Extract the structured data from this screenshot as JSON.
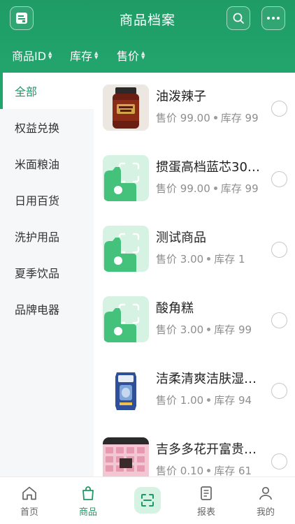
{
  "header": {
    "title": "商品档案",
    "logo_icon": "store-logo-icon",
    "search_icon": "search-icon",
    "more_icon": "more-dots-icon"
  },
  "sort_bar": {
    "items": [
      {
        "label": "商品ID"
      },
      {
        "label": "库存"
      },
      {
        "label": "售价"
      }
    ]
  },
  "sidebar": {
    "categories": [
      {
        "label": "全部",
        "active": true
      },
      {
        "label": "权益兑换"
      },
      {
        "label": "米面粮油"
      },
      {
        "label": "日用百货"
      },
      {
        "label": "洗护用品"
      },
      {
        "label": "夏季饮品"
      },
      {
        "label": "品牌电器"
      }
    ]
  },
  "products": {
    "price_prefix": "售价",
    "stock_prefix": "库存",
    "items": [
      {
        "name": "油泼辣子",
        "price": "99.00",
        "stock": "99",
        "image": "jar-photo"
      },
      {
        "name": "掼蛋高档蓝芯30…",
        "price": "99.00",
        "stock": "99",
        "image": "placeholder"
      },
      {
        "name": "测试商品",
        "price": "3.00",
        "stock": "1",
        "image": "placeholder"
      },
      {
        "name": "酸角糕",
        "price": "3.00",
        "stock": "99",
        "image": "placeholder"
      },
      {
        "name": "洁柔清爽洁肤湿…",
        "price": "1.00",
        "stock": "94",
        "image": "wipes-photo"
      },
      {
        "name": "吉多多花开富贵…",
        "price": "0.10",
        "stock": "61",
        "image": "box-photo"
      }
    ]
  },
  "tabbar": {
    "tabs": [
      {
        "label": "首页",
        "icon": "home-icon"
      },
      {
        "label": "商品",
        "icon": "shopping-bag-icon",
        "active": true
      },
      {
        "label": "",
        "icon": "scan-icon"
      },
      {
        "label": "报表",
        "icon": "report-icon"
      },
      {
        "label": "我的",
        "icon": "user-icon"
      }
    ]
  },
  "colors": {
    "brand_green": "#22a56d",
    "active_text": "#1c9a66",
    "placeholder_bg": "#d6f2e3"
  }
}
